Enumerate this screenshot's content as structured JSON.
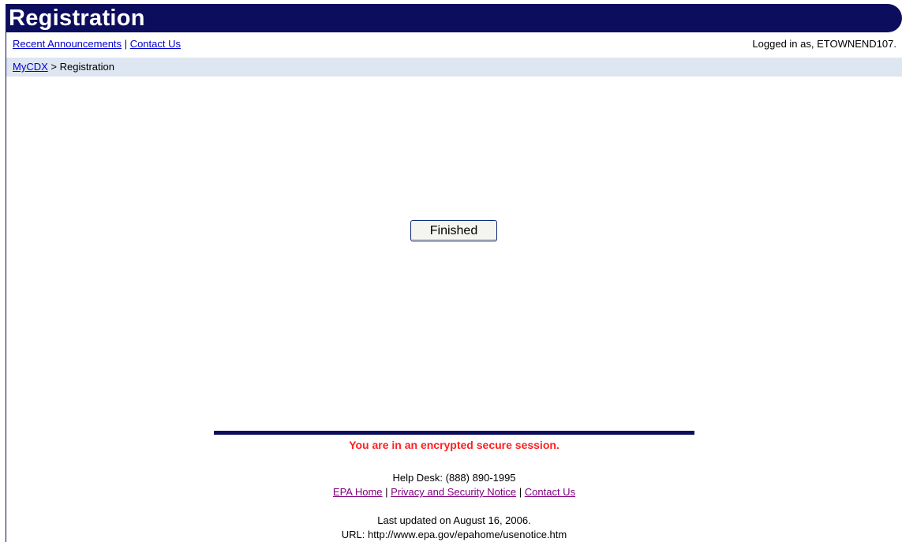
{
  "header": {
    "title": "Registration"
  },
  "top_links": {
    "recent_announcements": "Recent Announcements",
    "separator": "|",
    "contact_us": "Contact Us",
    "logged_in": "Logged in as, ETOWNEND107."
  },
  "breadcrumb": {
    "root": "MyCDX",
    "separator": ">",
    "current": "Registration"
  },
  "main": {
    "finished_label": "Finished"
  },
  "footer": {
    "secure_message": "You are in an encrypted secure session.",
    "help_desk": "Help Desk: (888) 890-1995",
    "epa_home": "EPA Home",
    "privacy_notice": "Privacy and Security Notice",
    "contact_us": "Contact Us",
    "separator": "|",
    "last_updated": "Last updated on August 16, 2006.",
    "url": "URL: http://www.epa.gov/epahome/usenotice.htm"
  },
  "colors": {
    "header_bg": "#0d0d5e",
    "breadcrumb_bg": "#dde6f1",
    "secure_text": "#ff2020",
    "link": "#0000cc",
    "visited_link": "#800080"
  }
}
